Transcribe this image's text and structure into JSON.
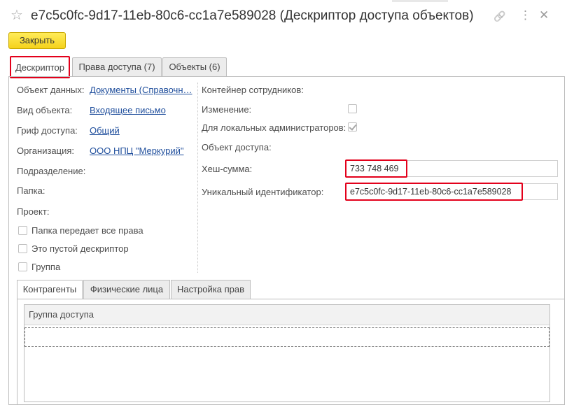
{
  "window": {
    "title": "e7c5c0fc-9d17-11eb-80c6-cc1a7e589028 (Дескриптор доступа объектов)",
    "star_icon": "☆",
    "link_icon": "🔗",
    "more_icon": "⋮",
    "close_icon": "✕"
  },
  "toolbar": {
    "close_label": "Закрыть"
  },
  "tabs": [
    {
      "label": "Дескриптор",
      "active": true
    },
    {
      "label": "Права доступа (7)",
      "active": false
    },
    {
      "label": "Объекты (6)",
      "active": false
    }
  ],
  "left": {
    "data_object_label": "Объект данных:",
    "data_object_value": "Документы (Справочн…",
    "object_kind_label": "Вид объекта:",
    "object_kind_value": "Входящее письмо",
    "grif_label": "Гриф доступа:",
    "grif_value": "Общий",
    "org_label": "Организация:",
    "org_value": "ООО НПЦ \"Меркурий\"",
    "subdivision_label": "Подразделение:",
    "folder_label": "Папка:",
    "project_label": "Проект:",
    "checkboxes": [
      {
        "label": "Папка передает все права",
        "checked": false
      },
      {
        "label": "Это пустой дескриптор",
        "checked": false
      },
      {
        "label": "Группа",
        "checked": false
      }
    ]
  },
  "right": {
    "container_label": "Контейнер сотрудников:",
    "change_label": "Изменение:",
    "change_checked": false,
    "local_admins_label": "Для локальных администраторов:",
    "local_admins_checked": true,
    "access_object_label": "Объект доступа:",
    "hash_label": "Хеш-сумма:",
    "hash_value": "733 748 469",
    "uid_label": "Уникальный идентификатор:",
    "uid_value": "e7c5c0fc-9d17-11eb-80c6-cc1a7e589028"
  },
  "bottom_tabs": [
    {
      "label": "Контрагенты",
      "active": true
    },
    {
      "label": "Физические лица",
      "active": false
    },
    {
      "label": "Настройка прав",
      "active": false
    }
  ],
  "table": {
    "columns": [
      "Группа доступа"
    ]
  },
  "colors": {
    "highlight": "#e3001b",
    "accent_button": "#f5d21b",
    "link": "#1f4e9c"
  }
}
